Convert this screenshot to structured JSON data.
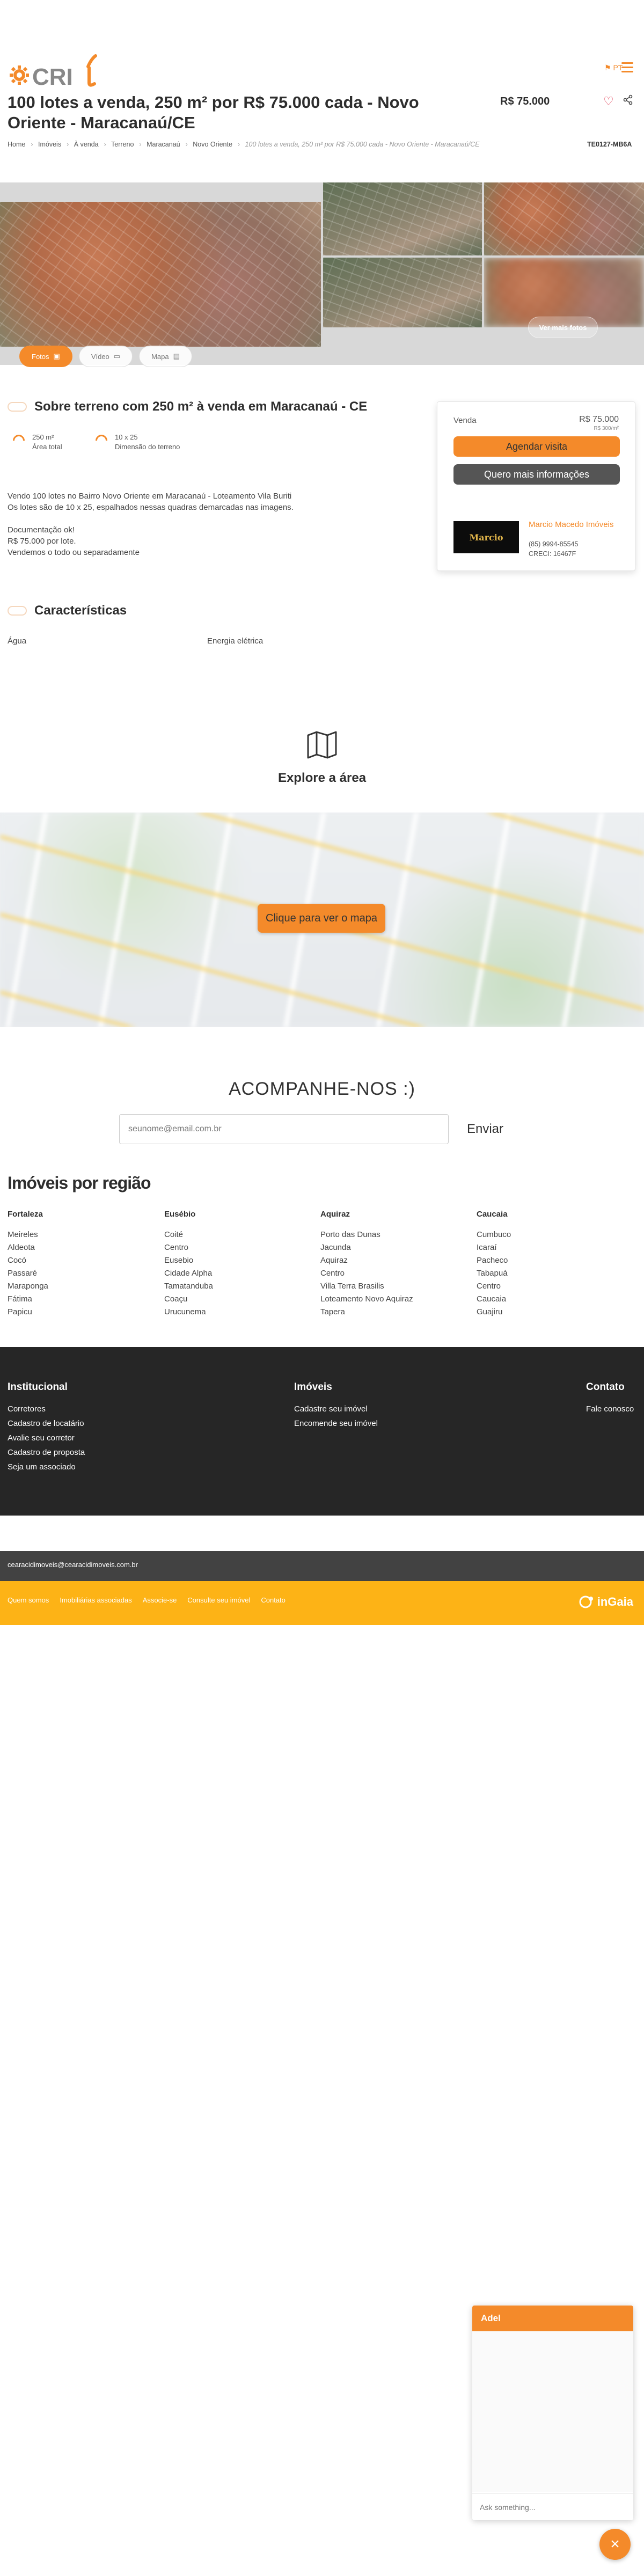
{
  "header": {
    "logo_text": "CRI",
    "language_label": "PT",
    "title": "100 lotes a venda, 250 m² por R$ 75.000 cada - Novo Oriente - Maracanaú/CE",
    "price": "R$ 75.000",
    "property_code": "TE0127-MB6A"
  },
  "breadcrumb": [
    "Home",
    "Imóveis",
    "À venda",
    "Terreno",
    "Maracanaú",
    "Novo Oriente",
    "100 lotes a venda, 250 m² por R$ 75.000 cada - Novo Oriente - Maracanaú/CE"
  ],
  "gallery": {
    "more_photos_label": "Ver mais fotos",
    "tabs": [
      {
        "label": "Fotos",
        "icon": "photos-icon",
        "active": true
      },
      {
        "label": "Vídeo",
        "icon": "video-icon",
        "active": false
      },
      {
        "label": "Mapa",
        "icon": "map-icon",
        "active": false
      }
    ]
  },
  "about": {
    "title": "Sobre terreno com 250 m² à venda em Maracanaú - CE",
    "stats": [
      {
        "value": "250 m²",
        "label": "Área total"
      },
      {
        "value": "10 x 25",
        "label": "Dimensão do terreno"
      }
    ],
    "description": [
      [
        "Vendo 100 lotes no Bairro Novo Oriente em Maracanaú - Loteamento Vila Buriti",
        "Os lotes são de 10 x 25, espalhados nessas quadras demarcadas nas imagens."
      ],
      [
        "Documentação ok!",
        "R$ 75.000 por lote.",
        "Vendemos o todo ou separadamente"
      ]
    ]
  },
  "card": {
    "sale_label": "Venda",
    "price": "R$ 75.000",
    "price_per_m2": "R$ 300/m²",
    "schedule_label": "Agendar visita",
    "info_label": "Quero mais informações",
    "agent_logo_text": "Marcio",
    "agent_name": "Marcio Macedo Imóveis",
    "agent_phone": "(85) 9994-85545",
    "agent_creci": "CRECI: 16467F"
  },
  "features": {
    "title": "Características",
    "items": [
      "Água",
      "Energia elétrica"
    ]
  },
  "explore": {
    "title": "Explore a área",
    "map_button": "Clique para ver o mapa"
  },
  "follow": {
    "title": "ACOMPANHE-NOS :)",
    "email_placeholder": "seunome@email.com.br",
    "send_label": "Enviar"
  },
  "regions": {
    "title": "Imóveis por região",
    "columns": [
      {
        "name": "Fortaleza",
        "items": [
          "Meireles",
          "Aldeota",
          "Cocó",
          "Passaré",
          "Maraponga",
          "Fátima",
          "Papicu"
        ]
      },
      {
        "name": "Eusébio",
        "items": [
          "Coité",
          "Centro",
          "Eusebio",
          "Cidade Alpha",
          "Tamatanduba",
          "Coaçu",
          "Urucunema"
        ]
      },
      {
        "name": "Aquiraz",
        "items": [
          "Porto das Dunas",
          "Jacunda",
          "Aquiraz",
          "Centro",
          "Villa Terra Brasilis",
          "Loteamento Novo Aquiraz",
          "Tapera"
        ]
      },
      {
        "name": "Caucaia",
        "items": [
          "Cumbuco",
          "Icaraí",
          "Pacheco",
          "Tabapuá",
          "Centro",
          "Caucaia",
          "Guajiru"
        ]
      }
    ]
  },
  "footer": {
    "institutional": {
      "title": "Institucional",
      "items": [
        "Corretores",
        "Cadastro de locatário",
        "Avalie seu corretor",
        "Cadastro de proposta",
        "Seja um associado"
      ]
    },
    "properties": {
      "title": "Imóveis",
      "items": [
        "Cadastre seu imóvel",
        "Encomende seu imóvel"
      ]
    },
    "contact": {
      "title": "Contato",
      "items": [
        "Fale conosco"
      ]
    },
    "email": "cearacidimoveis@cearacidimoveis.com.br",
    "links": [
      "Quem somos",
      "Imobiliárias associadas",
      "Associe-se",
      "Consulte seu imóvel",
      "Contato"
    ],
    "brand": "inGaia"
  },
  "chat": {
    "title": "Adel",
    "typing": "...",
    "input_placeholder": "Ask something..."
  },
  "colors": {
    "accent": "#f48a2a",
    "dark_footer": "#262626",
    "yellow_footer": "#fdb316"
  }
}
